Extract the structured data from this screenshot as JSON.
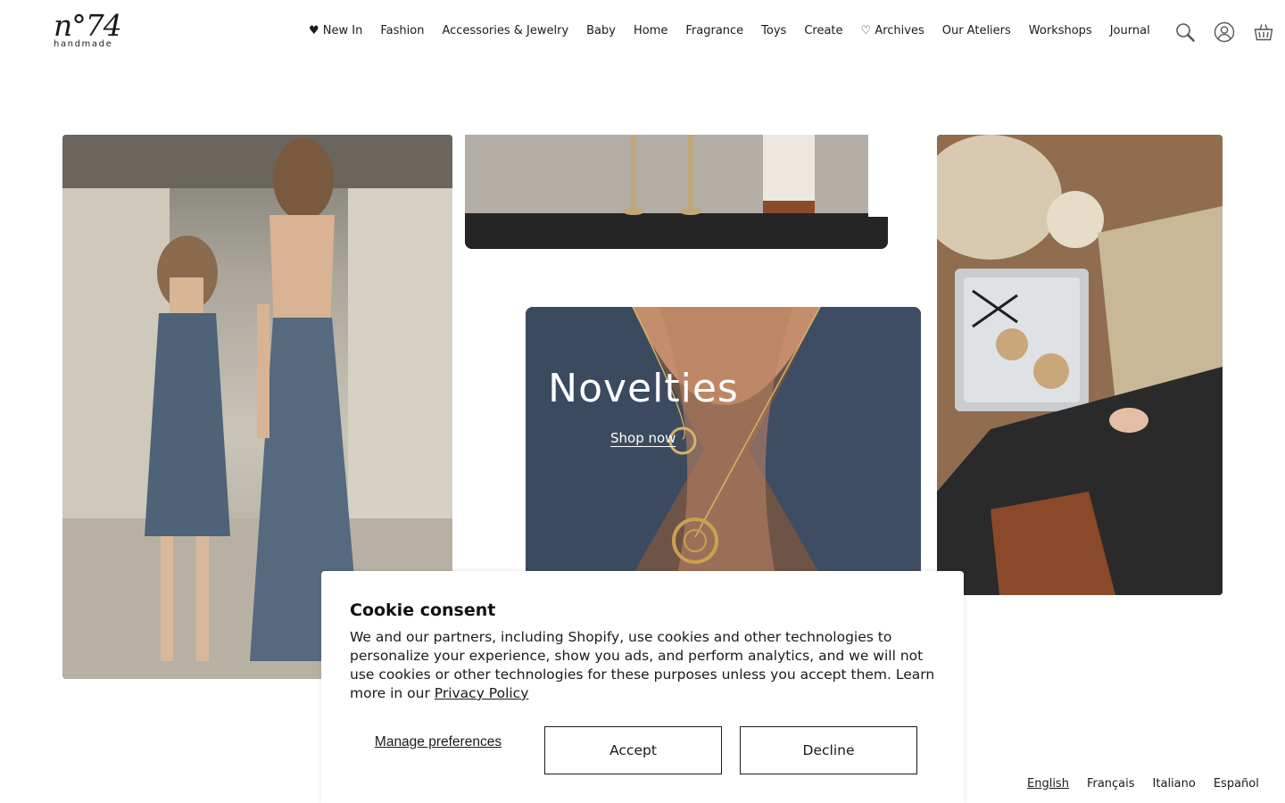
{
  "brand": {
    "logo_main": "n°74",
    "logo_sub": "handmade"
  },
  "nav": {
    "items": [
      {
        "label": "♥ New In"
      },
      {
        "label": "Fashion"
      },
      {
        "label": "Accessories & Jewelry"
      },
      {
        "label": "Baby"
      },
      {
        "label": "Home"
      },
      {
        "label": "Fragrance"
      },
      {
        "label": "Toys"
      },
      {
        "label": "Create"
      },
      {
        "label": "♡ Archives"
      },
      {
        "label": "Our Ateliers"
      },
      {
        "label": "Workshops"
      },
      {
        "label": "Journal"
      }
    ]
  },
  "header_icons": [
    "search-icon",
    "account-icon",
    "cart-icon"
  ],
  "hero": {
    "title": "Novelties",
    "cta": "Shop now"
  },
  "cookie": {
    "title": "Cookie consent",
    "body": "We and our partners, including Shopify, use cookies and other technologies to personalize your experience, show you ads, and perform analytics, and we will not use cookies or other technologies for these purposes unless you accept them. Learn more in our ",
    "link": "Privacy Policy",
    "manage": "Manage preferences",
    "accept": "Accept",
    "decline": "Decline"
  },
  "languages": {
    "items": [
      {
        "label": "English",
        "active": true
      },
      {
        "label": "Français"
      },
      {
        "label": "Italiano"
      },
      {
        "label": "Español"
      }
    ]
  },
  "colors": {
    "text": "#1a1a1a",
    "background": "#ffffff"
  }
}
